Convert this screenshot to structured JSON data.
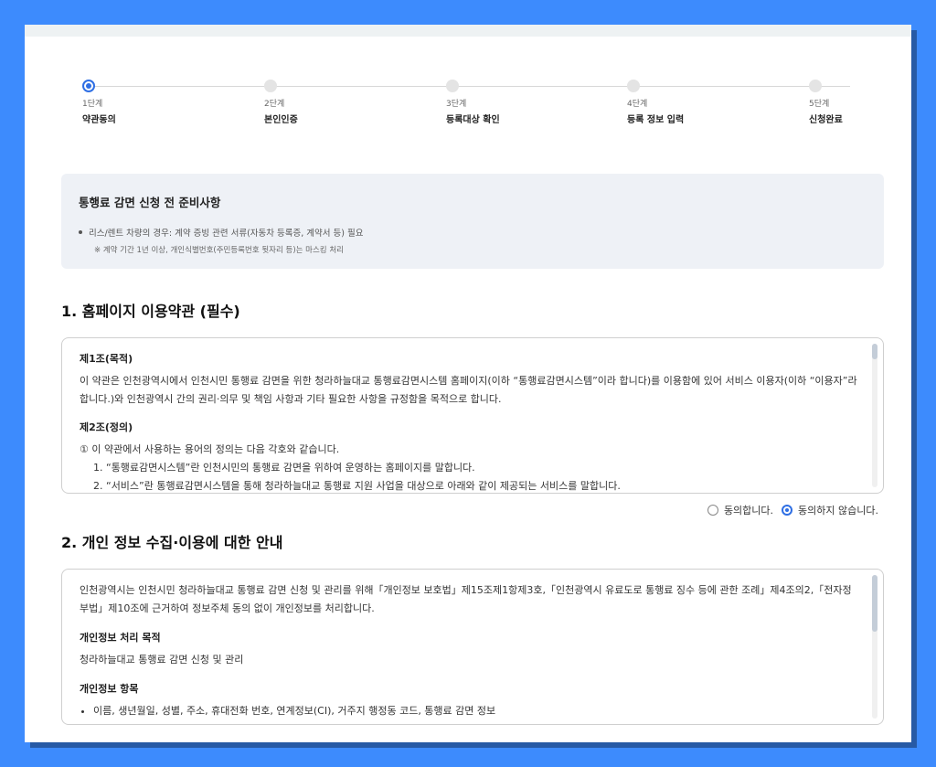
{
  "stepper": {
    "steps": [
      {
        "num": "1단계",
        "name": "약관동의",
        "active": true
      },
      {
        "num": "2단계",
        "name": "본인인증",
        "active": false
      },
      {
        "num": "3단계",
        "name": "등록대상 확인",
        "active": false
      },
      {
        "num": "4단계",
        "name": "등록 정보 입력",
        "active": false
      },
      {
        "num": "5단계",
        "name": "신청완료",
        "active": false
      }
    ]
  },
  "notice": {
    "title": "통행료 감면 신청 전 준비사항",
    "bullet": "리스/렌트 차량의 경우: 계약 증빙 관련 서류(자동차 등록증, 계약서 등) 필요",
    "note": "※ 계약 기간 1년 이상, 개인식별번호(주민등록번호 뒷자리 등)는 마스킹 처리"
  },
  "section1": {
    "title": "1. 홈페이지 이용약관 (필수)",
    "article1_title": "제1조(목적)",
    "article1_body": "이 약관은 인천광역시에서 인천시민 통행료 감면을 위한 청라하늘대교 통행료감면시스템 홈페이지(이하 “통행료감면시스템”이라 합니다)를 이용함에 있어 서비스 이용자(이하 “이용자”라 합니다.)와 인천광역시 간의 권리·의무 및 책임 사항과 기타 필요한 사항을 규정함을 목적으로 합니다.",
    "article2_title": "제2조(정의)",
    "article2_intro": "① 이 약관에서 사용하는 용어의 정의는 다음 각호와 같습니다.",
    "article2_item1": "1. “통행료감면시스템”란 인천시민의 통행료 감면을 위하여 운영하는 홈페이지를 말합니다.",
    "article2_item2": "2. “서비스”란 통행료감면시스템을 통해 청라하늘대교 통행료 지원 사업을 대상으로 아래와 같이 제공되는 서비스를 말합니다."
  },
  "agreement": {
    "agree_label": "동의합니다.",
    "disagree_label": "동의하지 않습니다.",
    "selected": "disagree"
  },
  "section2": {
    "title": "2. 개인 정보 수집·이용에 대한 안내",
    "intro": "인천광역시는 인천시민 청라하늘대교 통행료 감면 신청 및 관리를 위해「개인정보 보호법」제15조제1항제3호,「인천광역시 유료도로 통행료 징수 등에 관한 조례」제4조의2,「전자정부법」제10조에 근거하여 정보주체 동의 없이 개인정보를 처리합니다.",
    "purpose_title": "개인정보 처리 목적",
    "purpose_body": "청라하늘대교 통행료 감면 신청 및 관리",
    "items_title": "개인정보 항목",
    "items_body": "이름, 생년월일, 성별, 주소, 휴대전화 번호, 연계정보(CI), 거주지 행정동 코드, 통행료 감면 정보"
  },
  "colors": {
    "background": "#3d8bfd",
    "accent": "#2f6fe4"
  }
}
